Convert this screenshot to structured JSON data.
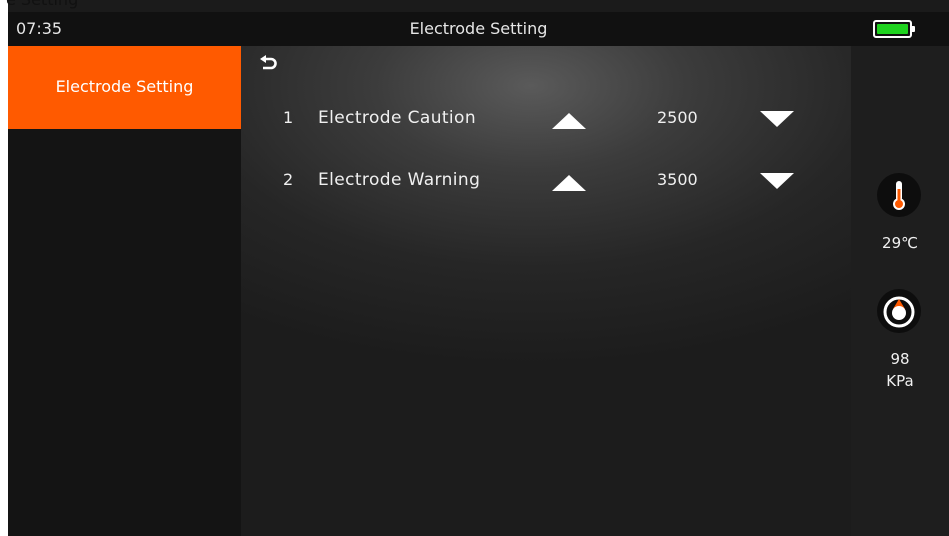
{
  "caption": "e Setting",
  "topbar": {
    "time": "07:35",
    "title": "Electrode Setting",
    "battery_level": 1.0,
    "battery_color": "#1fd31f"
  },
  "sidebar": {
    "items": [
      {
        "label": "Electrode Setting",
        "active": true
      }
    ],
    "active_color": "#ff5a00"
  },
  "main": {
    "back_icon": "return-arrow-icon",
    "rows": [
      {
        "num": "1",
        "label": "Electrode Caution",
        "value": "2500"
      },
      {
        "num": "2",
        "label": "Electrode Warning",
        "value": "3500"
      }
    ]
  },
  "status": {
    "temperature": "29℃",
    "pressure_value": "98",
    "pressure_unit": "KPa",
    "temperature_icon": "thermometer-icon",
    "pressure_icon": "pressure-gauge-icon"
  }
}
